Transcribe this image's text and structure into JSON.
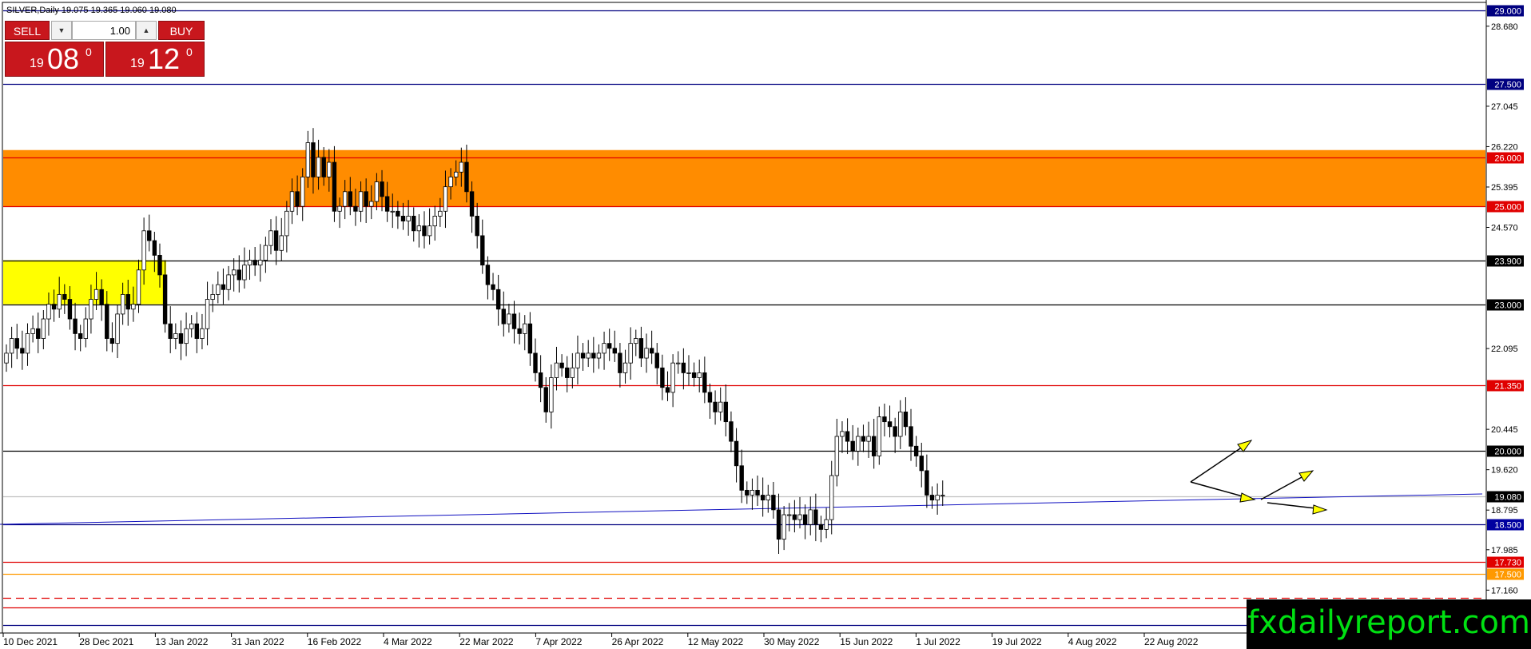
{
  "header": {
    "symbol_info": "SILVER,Daily  19.075 19.365 19.060 19.080"
  },
  "trade_panel": {
    "sell_label": "SELL",
    "buy_label": "BUY",
    "lot": "1.00",
    "sell_small": "19",
    "sell_big": "08",
    "sell_sup": "0",
    "buy_small": "19",
    "buy_big": "12",
    "buy_sup": "0"
  },
  "watermark": "fxdailyreport.com",
  "colors": {
    "background": "#ffffff",
    "bull_candle": "#ffffff",
    "bear_candle": "#000000",
    "resistance_zone": "#ff8c00",
    "support_zone": "#ffff00",
    "red_level": "#e00000",
    "blue_level": "#000080",
    "arrow": "#ffff00"
  },
  "chart_data": {
    "type": "candlestick",
    "symbol": "SILVER",
    "timeframe": "Daily",
    "ylim": [
      16.3,
      29.15
    ],
    "x_tick_labels": [
      "10 Dec 2021",
      "28 Dec 2021",
      "13 Jan 2022",
      "31 Jan 2022",
      "16 Feb 2022",
      "4 Mar 2022",
      "22 Mar 2022",
      "7 Apr 2022",
      "26 Apr 2022",
      "12 May 2022",
      "30 May 2022",
      "15 Jun 2022",
      "1 Jul 2022",
      "19 Jul 2022",
      "4 Aug 2022",
      "22 Aug 2022"
    ],
    "y_tick_labels": [
      28.68,
      27.045,
      26.22,
      25.395,
      24.57,
      22.095,
      20.445,
      19.62,
      18.795,
      17.985,
      17.16
    ],
    "levels": [
      {
        "value": 29.0,
        "label": "29.000",
        "color": "#000080",
        "label_bg": "#000080"
      },
      {
        "value": 27.5,
        "label": "27.500",
        "color": "#000080",
        "label_bg": "#000080"
      },
      {
        "value": 26.0,
        "label": "26.000",
        "color": "#e00000",
        "label_bg": "#e00000"
      },
      {
        "value": 25.0,
        "label": "25.000",
        "color": "#e00000",
        "label_bg": "#e00000"
      },
      {
        "value": 23.9,
        "label": "23.900",
        "color": "#000000",
        "label_bg": "#000000"
      },
      {
        "value": 23.0,
        "label": "23.000",
        "color": "#000000",
        "label_bg": "#000000"
      },
      {
        "value": 21.35,
        "label": "21.350",
        "color": "#e00000",
        "label_bg": "#e00000"
      },
      {
        "value": 20.0,
        "label": "20.000",
        "color": "#000000",
        "label_bg": "#000000"
      },
      {
        "value": 19.08,
        "label": "19.080",
        "color": "#c0c0c0",
        "label_bg": "#000000"
      },
      {
        "value": 18.5,
        "label": "18.500",
        "color": "#000080",
        "label_bg": "#0000a0"
      },
      {
        "value": 17.73,
        "label": "17.730",
        "color": "#e00000",
        "label_bg": "#e00000"
      },
      {
        "value": 17.5,
        "label": "17.500",
        "color": "#ff9900",
        "label_bg": "#ff9900"
      },
      {
        "value": 17.0,
        "label": "",
        "color": "#e00000",
        "dashed": true
      },
      {
        "value": 16.8,
        "label": "16.800",
        "color": "#e00000",
        "label_bg": "#e00000"
      },
      {
        "value": 16.45,
        "label": "",
        "color": "#000080"
      }
    ],
    "zones": [
      {
        "name": "resistance",
        "from": 25.0,
        "to": 26.15,
        "color": "#ff8c00",
        "x_from": 0,
        "x_to": 1
      },
      {
        "name": "support",
        "from": 23.0,
        "to": 23.9,
        "color": "#ffff00",
        "x_from": 0,
        "x_to": 0.11
      }
    ],
    "close_series": [
      22.0,
      22.3,
      22.1,
      22.0,
      22.4,
      22.5,
      22.3,
      22.7,
      23.0,
      22.9,
      23.2,
      23.1,
      22.7,
      22.4,
      22.3,
      22.7,
      23.1,
      23.3,
      23.0,
      22.3,
      22.2,
      22.8,
      23.2,
      22.9,
      23.0,
      23.7,
      24.5,
      24.3,
      24.0,
      23.6,
      22.6,
      22.3,
      22.4,
      22.2,
      22.5,
      22.6,
      22.3,
      22.5,
      23.1,
      23.2,
      23.4,
      23.3,
      23.6,
      23.7,
      23.5,
      23.8,
      23.9,
      23.8,
      23.9,
      24.2,
      24.5,
      24.1,
      24.4,
      24.9,
      25.3,
      25.0,
      25.6,
      26.3,
      25.6,
      26.0,
      25.6,
      25.9,
      24.9,
      25.0,
      25.3,
      25.0,
      24.9,
      25.3,
      25.0,
      25.1,
      25.5,
      25.2,
      24.9,
      24.9,
      24.8,
      24.7,
      24.8,
      24.5,
      24.6,
      24.4,
      24.6,
      24.8,
      24.9,
      25.4,
      25.6,
      25.7,
      25.9,
      25.3,
      24.8,
      24.4,
      23.8,
      23.4,
      23.3,
      22.9,
      22.6,
      22.8,
      22.5,
      22.4,
      22.6,
      22.0,
      21.6,
      21.3,
      20.8,
      21.5,
      21.8,
      21.7,
      21.5,
      21.7,
      22.0,
      21.9,
      22.0,
      21.9,
      22.0,
      22.2,
      22.1,
      22.0,
      21.6,
      21.8,
      22.2,
      22.3,
      21.9,
      22.1,
      22.0,
      21.7,
      21.3,
      21.2,
      21.8,
      21.8,
      21.6,
      21.6,
      21.5,
      21.6,
      21.2,
      21.0,
      20.8,
      21.0,
      20.6,
      20.2,
      19.7,
      19.2,
      19.1,
      19.2,
      19.1,
      19.0,
      19.1,
      18.8,
      18.2,
      18.7,
      18.7,
      18.6,
      18.7,
      18.5,
      18.8,
      18.5,
      18.4,
      18.6,
      19.5,
      20.3,
      20.4,
      20.2,
      20.0,
      20.3,
      20.2,
      20.3,
      19.9,
      20.7,
      20.6,
      20.5,
      20.3,
      20.8,
      20.5,
      20.1,
      19.9,
      19.6,
      19.1,
      19.0,
      19.1,
      19.1
    ]
  }
}
